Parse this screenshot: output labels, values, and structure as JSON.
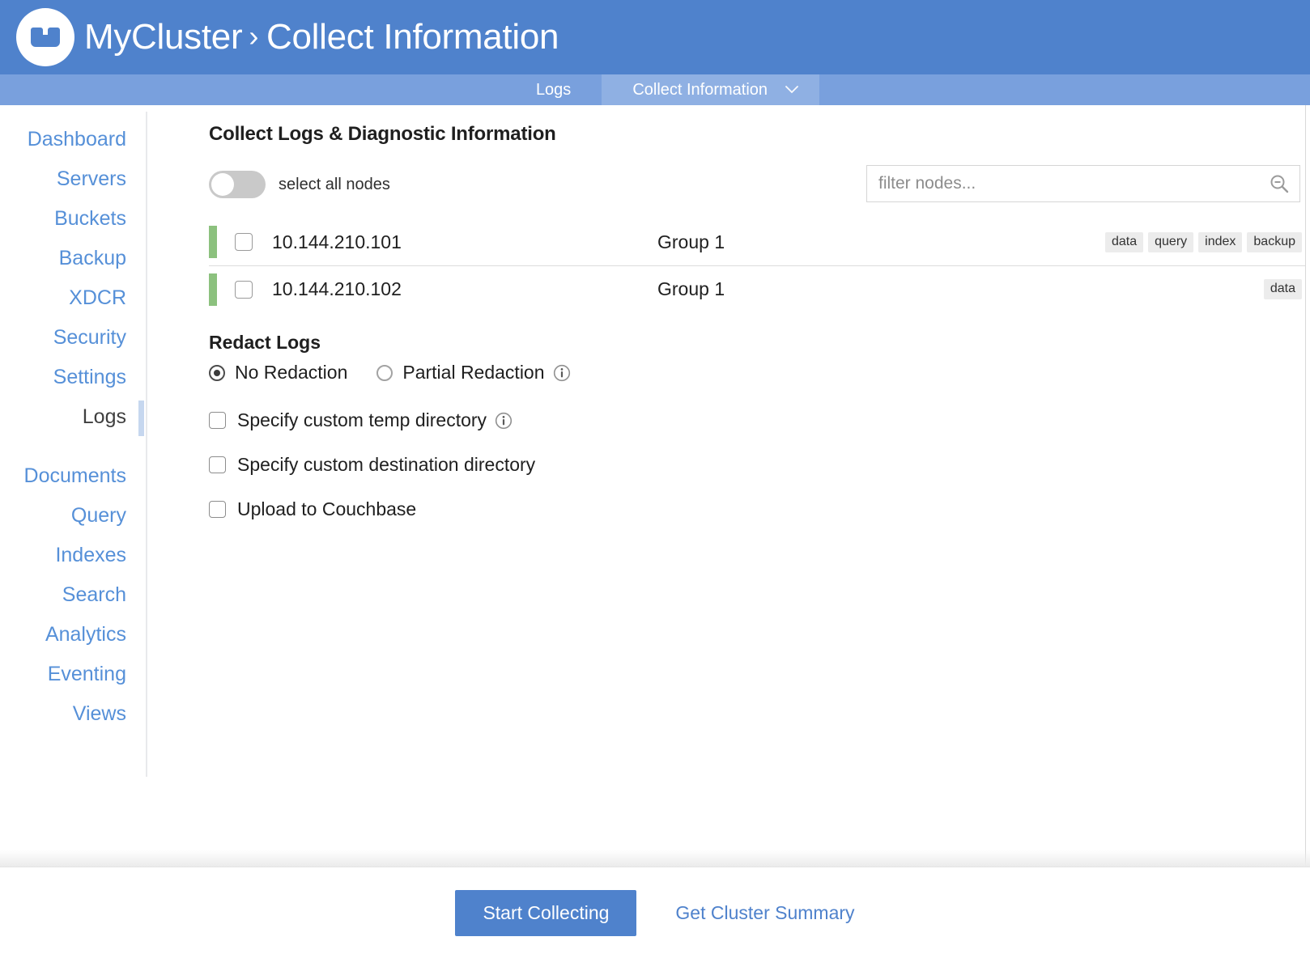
{
  "header": {
    "logo_icon": "couchbase-logo-icon",
    "cluster_name": "MyCluster",
    "breadcrumb_separator": "›",
    "page_name": "Collect Information"
  },
  "tabs": [
    {
      "label": "Logs",
      "active": false
    },
    {
      "label": "Collect Information",
      "active": true,
      "caret": "⌄"
    }
  ],
  "sidebar": {
    "items": [
      {
        "label": "Dashboard",
        "active": false
      },
      {
        "label": "Servers",
        "active": false
      },
      {
        "label": "Buckets",
        "active": false
      },
      {
        "label": "Backup",
        "active": false
      },
      {
        "label": "XDCR",
        "active": false
      },
      {
        "label": "Security",
        "active": false
      },
      {
        "label": "Settings",
        "active": false
      },
      {
        "label": "Logs",
        "active": true
      }
    ],
    "items2": [
      {
        "label": "Documents",
        "active": false
      },
      {
        "label": "Query",
        "active": false
      },
      {
        "label": "Indexes",
        "active": false
      },
      {
        "label": "Search",
        "active": false
      },
      {
        "label": "Analytics",
        "active": false
      },
      {
        "label": "Eventing",
        "active": false
      },
      {
        "label": "Views",
        "active": false
      }
    ]
  },
  "main": {
    "section_title": "Collect Logs & Diagnostic Information",
    "select_all": {
      "label": "select all nodes",
      "toggle_on": false
    },
    "filter": {
      "value": "",
      "placeholder": "filter nodes...",
      "icon": "search-icon"
    },
    "nodes": [
      {
        "ip": "10.144.210.101",
        "group": "Group 1",
        "checked": false,
        "status_color": "#8cc17e",
        "services": [
          "data",
          "query",
          "index",
          "backup"
        ]
      },
      {
        "ip": "10.144.210.102",
        "group": "Group 1",
        "checked": false,
        "status_color": "#8cc17e",
        "services": [
          "data"
        ]
      }
    ],
    "redact": {
      "title": "Redact Logs",
      "options": [
        {
          "label": "No Redaction",
          "selected": true,
          "info": false
        },
        {
          "label": "Partial Redaction",
          "selected": false,
          "info": true
        }
      ]
    },
    "checkboxes": [
      {
        "label": "Specify custom temp directory",
        "checked": false,
        "info": true
      },
      {
        "label": "Specify custom destination directory",
        "checked": false,
        "info": false
      },
      {
        "label": "Upload to Couchbase",
        "checked": false,
        "info": false
      }
    ]
  },
  "footer": {
    "primary_button": "Start Collecting",
    "link_button": "Get Cluster Summary"
  },
  "colors": {
    "header_blue": "#4f82cc",
    "tabbar_blue": "#79a0dd",
    "tab_active_blue": "#8fb0e3",
    "link_blue": "#5690d8",
    "status_green": "#8cc17e",
    "active_indicator": "#c6d7ef"
  }
}
